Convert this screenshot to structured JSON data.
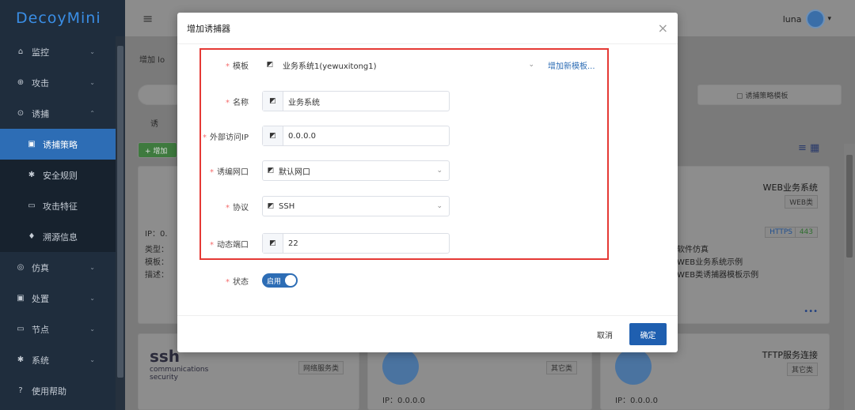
{
  "app": {
    "logo": "DecoyMini"
  },
  "sidebar": {
    "items": [
      {
        "label": "监控",
        "icon": "home-icon",
        "glyph": "⌂",
        "chevron": "⌄"
      },
      {
        "label": "攻击",
        "icon": "target-icon",
        "glyph": "⊕",
        "chevron": "⌄"
      },
      {
        "label": "诱捕",
        "icon": "radar-icon",
        "glyph": "⊙",
        "chevron": "⌃"
      },
      {
        "label": "诱捕策略",
        "icon": "lock-icon",
        "glyph": "▣",
        "sub": true,
        "active": true
      },
      {
        "label": "安全规则",
        "icon": "bug-icon",
        "glyph": "✱",
        "sub": true
      },
      {
        "label": "攻击特征",
        "icon": "terminal-icon",
        "glyph": "▭",
        "sub": true
      },
      {
        "label": "溯源信息",
        "icon": "pin-icon",
        "glyph": "♦",
        "sub": true
      },
      {
        "label": "仿真",
        "icon": "sim-icon",
        "glyph": "◎",
        "chevron": "⌄"
      },
      {
        "label": "处置",
        "icon": "briefcase-icon",
        "glyph": "▣",
        "chevron": "⌄"
      },
      {
        "label": "节点",
        "icon": "monitor-icon",
        "glyph": "▭",
        "chevron": "⌄"
      },
      {
        "label": "系统",
        "icon": "gear-icon",
        "glyph": "✱",
        "chevron": "⌄"
      },
      {
        "label": "使用帮助",
        "icon": "help-icon",
        "glyph": "?"
      }
    ]
  },
  "header": {
    "menu_glyph": "≡",
    "user": "luna",
    "user_chevron": "▾"
  },
  "background": {
    "breadcrumb": "增加 lo",
    "filter_text": "▢ 诱捕策略模板",
    "tab_text": "诱",
    "add_btn": "+ 增加",
    "view_glyph": "≡ ▦",
    "card_ip": "IP：0.",
    "card_type": "类型：",
    "card_template": "模板：",
    "card_desc": "描述：",
    "web_title": "WEB业务系统",
    "web_tag": "WEB类",
    "https_tag": "HTTPS",
    "port_tag": "443",
    "line1": "软件仿真",
    "line2": "WEB业务系统示例",
    "line3": "WEB类诱捕器模板示例",
    "more": "•••",
    "ssh_logo": "ssh",
    "ssh_sub": "communications security",
    "net_tag": "网络服务类",
    "other_tag": "其它类",
    "tftp_title": "TFTP服务连接",
    "other_tag2": "其它类",
    "ip_bottom": "IP：0.0.0.0"
  },
  "modal": {
    "title": "增加诱捕器",
    "close": "×",
    "fields": {
      "template": {
        "label": "模板",
        "value": "业务系统1(yewuxitong1)",
        "link": "增加新模板..."
      },
      "name": {
        "label": "名称",
        "value": "业务系统"
      },
      "ext_ip": {
        "label": "外部访问IP",
        "value": "0.0.0.0"
      },
      "nic": {
        "label": "诱编网口",
        "value": "默认网口"
      },
      "protocol": {
        "label": "协议",
        "value": "SSH"
      },
      "port": {
        "label": "动态端口",
        "value": "22"
      },
      "status": {
        "label": "状态",
        "value": "启用"
      }
    },
    "prefix_glyph": "◩",
    "required_mark": "*",
    "caret": "⌄",
    "cancel": "取消",
    "ok": "确定"
  },
  "colors": {
    "accent": "#2d6db5",
    "highlight": "#e53935",
    "sidebar": "#1f2d3d"
  }
}
